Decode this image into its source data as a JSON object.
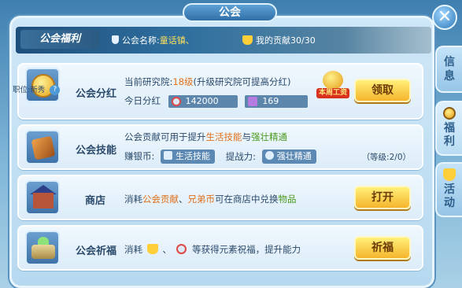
{
  "window": {
    "title": "公会",
    "close_label": "✕"
  },
  "banner": {
    "title": "公会福利",
    "guild_label": "公会名称:",
    "guild_value": "童话镇、",
    "contribution_label": "我的贡献",
    "contribution_value": "30/30"
  },
  "rows": {
    "dividend": {
      "name": "公会分红",
      "rank_label": "职位:新秀",
      "research_prefix": "当前研究院:",
      "research_level": "18级",
      "research_suffix": "(升级研究院可提高分红)",
      "today_label": "今日分红",
      "stat1": "142000",
      "stat2": "169",
      "badge_text": "本周工资",
      "button": "领取"
    },
    "skills": {
      "name": "公会技能",
      "line1_a": "公会贡献可用于提升",
      "line1_b": "生活技能",
      "line1_c": "与",
      "line1_d": "强壮精通",
      "earn_label": "赚银币:",
      "earn_chip": "生活技能",
      "power_label": "提战力:",
      "power_chip": "强壮精通",
      "level_text": "（等级:2/0）"
    },
    "shop": {
      "name": "商店",
      "t1": "消耗",
      "t2": "公会贡献",
      "t3": "、",
      "t4": "兄弟币",
      "t5": "可在商店中兑换",
      "t6": "物品",
      "button": "打开"
    },
    "pray": {
      "name": "公会祈福",
      "t1": "消耗",
      "t2": "、",
      "t3": "等获得元素祝福，提升能力",
      "button": "祈福"
    }
  },
  "tabs": [
    {
      "label": "信息"
    },
    {
      "label": "福利"
    },
    {
      "label": "活动"
    }
  ],
  "colors": {
    "accent_orange": "#e0701a",
    "accent_green": "#4a9a1d",
    "button_gold": "#f5b52b"
  }
}
